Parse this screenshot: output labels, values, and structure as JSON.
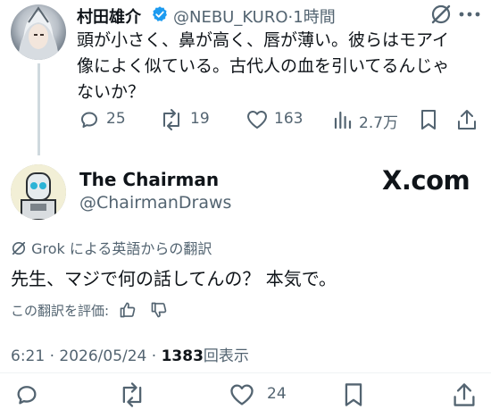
{
  "reply_tweet": {
    "display_name": "村田雄介",
    "handle": "@NEBU_KURO",
    "separator": "·",
    "time": "1時間",
    "text_line1": "頭が小さく、鼻が高く、唇が薄い。彼らはモアイ",
    "text_line2": "像によく似ている。古代人の血を引いてるんじゃ",
    "text_line3": "ないか？",
    "actions": {
      "replies": "25",
      "reposts": "19",
      "likes": "163",
      "views": "2.7万"
    }
  },
  "main_tweet": {
    "display_name": "The Chairman",
    "handle": "@ChairmanDraws",
    "watermark": "X.com",
    "translation_note": "Grok による英語からの翻訳",
    "text": "先生、マジで何の話してんの？ 本気で。",
    "rate_translation": "この翻訳を評価:",
    "timestamp": "6:21 · 2026/05/24 · ",
    "view_count": "1383",
    "views_label": "回表示",
    "actions": {
      "likes": "24"
    }
  },
  "colors": {
    "text": "#0f1419",
    "muted": "#536471",
    "verified": "#1d9bf0",
    "divider": "#cfd9de"
  }
}
